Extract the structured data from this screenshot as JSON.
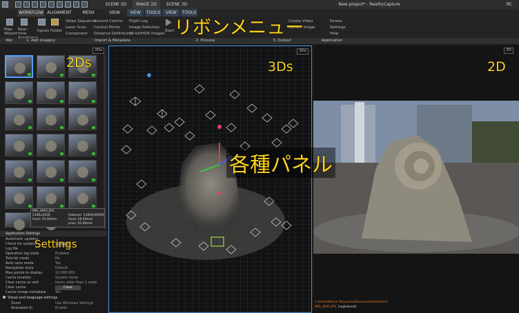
{
  "titlebar": {
    "tabs": [
      "SCENE 2D",
      "IMAGE 2D",
      "SCENE 3D"
    ],
    "title": "New project* - RealityCapture",
    "right": "RC"
  },
  "menu": [
    "WORKFLOW",
    "ALIGNMENT",
    "MESH MODEL",
    "VIEW",
    "VIEW",
    "TOOLS",
    "VIEW",
    "TOOLS"
  ],
  "ribbon": {
    "map_wizard": "Map Wizard",
    "realtime": "Real-time Assistance",
    "inputs": "Inputs",
    "folder": "Folder",
    "col1": [
      "Video Sequence",
      "Laser Scan",
      "Component"
    ],
    "col2": [
      "Ground Control",
      "Control Points",
      "Distance Definitions"
    ],
    "col3": [
      "Flight Log",
      "Image Selection",
      "16-bit/HDR Images"
    ],
    "start": "Start",
    "output1": "Create Video",
    "output2": "Render Image",
    "app": [
      "Panels",
      "Settings",
      "Help"
    ],
    "groups": [
      "Wiz",
      "1. Add imagery",
      "Import & Metadata",
      "2. Process",
      "3. Output",
      "Application"
    ]
  },
  "annotations": {
    "ribbon": "リボンメニュー",
    "twods": "2Ds",
    "threeds": "3Ds",
    "twod": "2D",
    "panels": "各種パネル",
    "settings": "Settings"
  },
  "panel_tags": {
    "p2ds": "2Ds",
    "p3ds": "3Ds",
    "p2d": "2D"
  },
  "tooltip": [
    "IMG_4991.JPG",
    "5184x3456",
    "focal: 25.00mm",
    "features: 13464/40000",
    "focal: 26.40mm",
    "prior: 25.00mm"
  ],
  "settings": {
    "title": "Application Settings",
    "rows": [
      {
        "k": "Automatic updates",
        "v": ""
      },
      {
        "k": "Check for updates",
        "v": "Check"
      },
      {
        "k": "Log file",
        "v": ""
      },
      {
        "k": "Operation log state",
        "v": "Enabled"
      },
      {
        "k": "Tutorial mode",
        "v": "No"
      },
      {
        "k": "Auto save mode",
        "v": "Yes"
      },
      {
        "k": "Navigation style",
        "v": "Default"
      },
      {
        "k": "Max points to display",
        "v": "10 000 000"
      },
      {
        "k": "Cache location",
        "v": "System temp"
      },
      {
        "k": "Clear cache on exit",
        "v": "Items older than 1 week"
      },
      {
        "k": "Clear cache",
        "v": "Clear"
      },
      {
        "k": "Cache image metadata",
        "v": "Yes"
      },
      {
        "k": "Visual and language settings",
        "v": ""
      },
      {
        "k": "Zoom",
        "v": "Use Windows Settings"
      },
      {
        "k": "Animated UI",
        "v": "Enable"
      }
    ]
  },
  "view2d_path": "C:\\Users\\Kibira Yokayama\\Downloads\\Ankhilos\\",
  "view2d_file": "IMG_4991.JPG",
  "view2d_registered": "[registered]"
}
